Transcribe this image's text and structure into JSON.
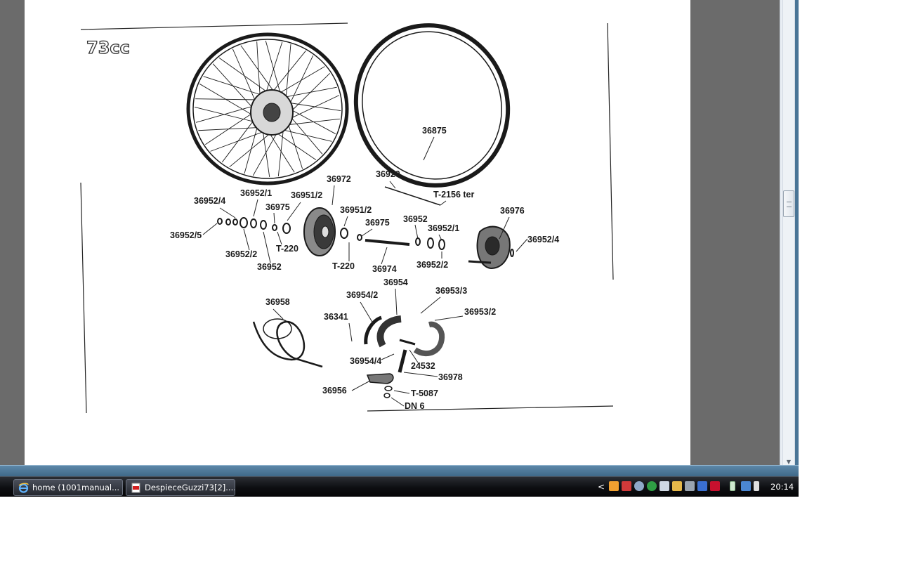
{
  "diagram": {
    "badge": "73cc",
    "labels": {
      "l1": "36875",
      "l2": "36920",
      "l3": "T-2156 ter",
      "l4": "36972",
      "l5": "36952/1",
      "l6": "36951/2",
      "l7": "36952/4",
      "l8": "36975",
      "l9": "36951/2",
      "l10": "36975",
      "l11": "36952",
      "l12": "36952/1",
      "l13": "36976",
      "l14": "36952/4",
      "l15": "36952/5",
      "l16": "T-220",
      "l17": "36952/2",
      "l18": "36952",
      "l19": "T-220",
      "l20": "36974",
      "l21": "36952/2",
      "l22": "36954",
      "l23": "36953/3",
      "l24": "36958",
      "l25": "36954/2",
      "l26": "36953/2",
      "l27": "36341",
      "l28": "36954/4",
      "l29": "24532",
      "l30": "36978",
      "l31": "36956",
      "l32": "T-5087",
      "l33": "DN 6"
    }
  },
  "taskbar": {
    "buttons": [
      {
        "label": "home (1001manual...",
        "icon": "internet-explorer-icon"
      },
      {
        "label": "DespieceGuzzi73[2]....",
        "icon": "pdf-document-icon"
      }
    ],
    "tray_expand": "<",
    "clock": "20:14"
  },
  "scrollbar": {
    "down_arrow": "▼"
  },
  "colors": {
    "desktop_gray": "#6b6b6b",
    "taskbar": "#0d0e11",
    "window_frame": "#4a7596"
  }
}
